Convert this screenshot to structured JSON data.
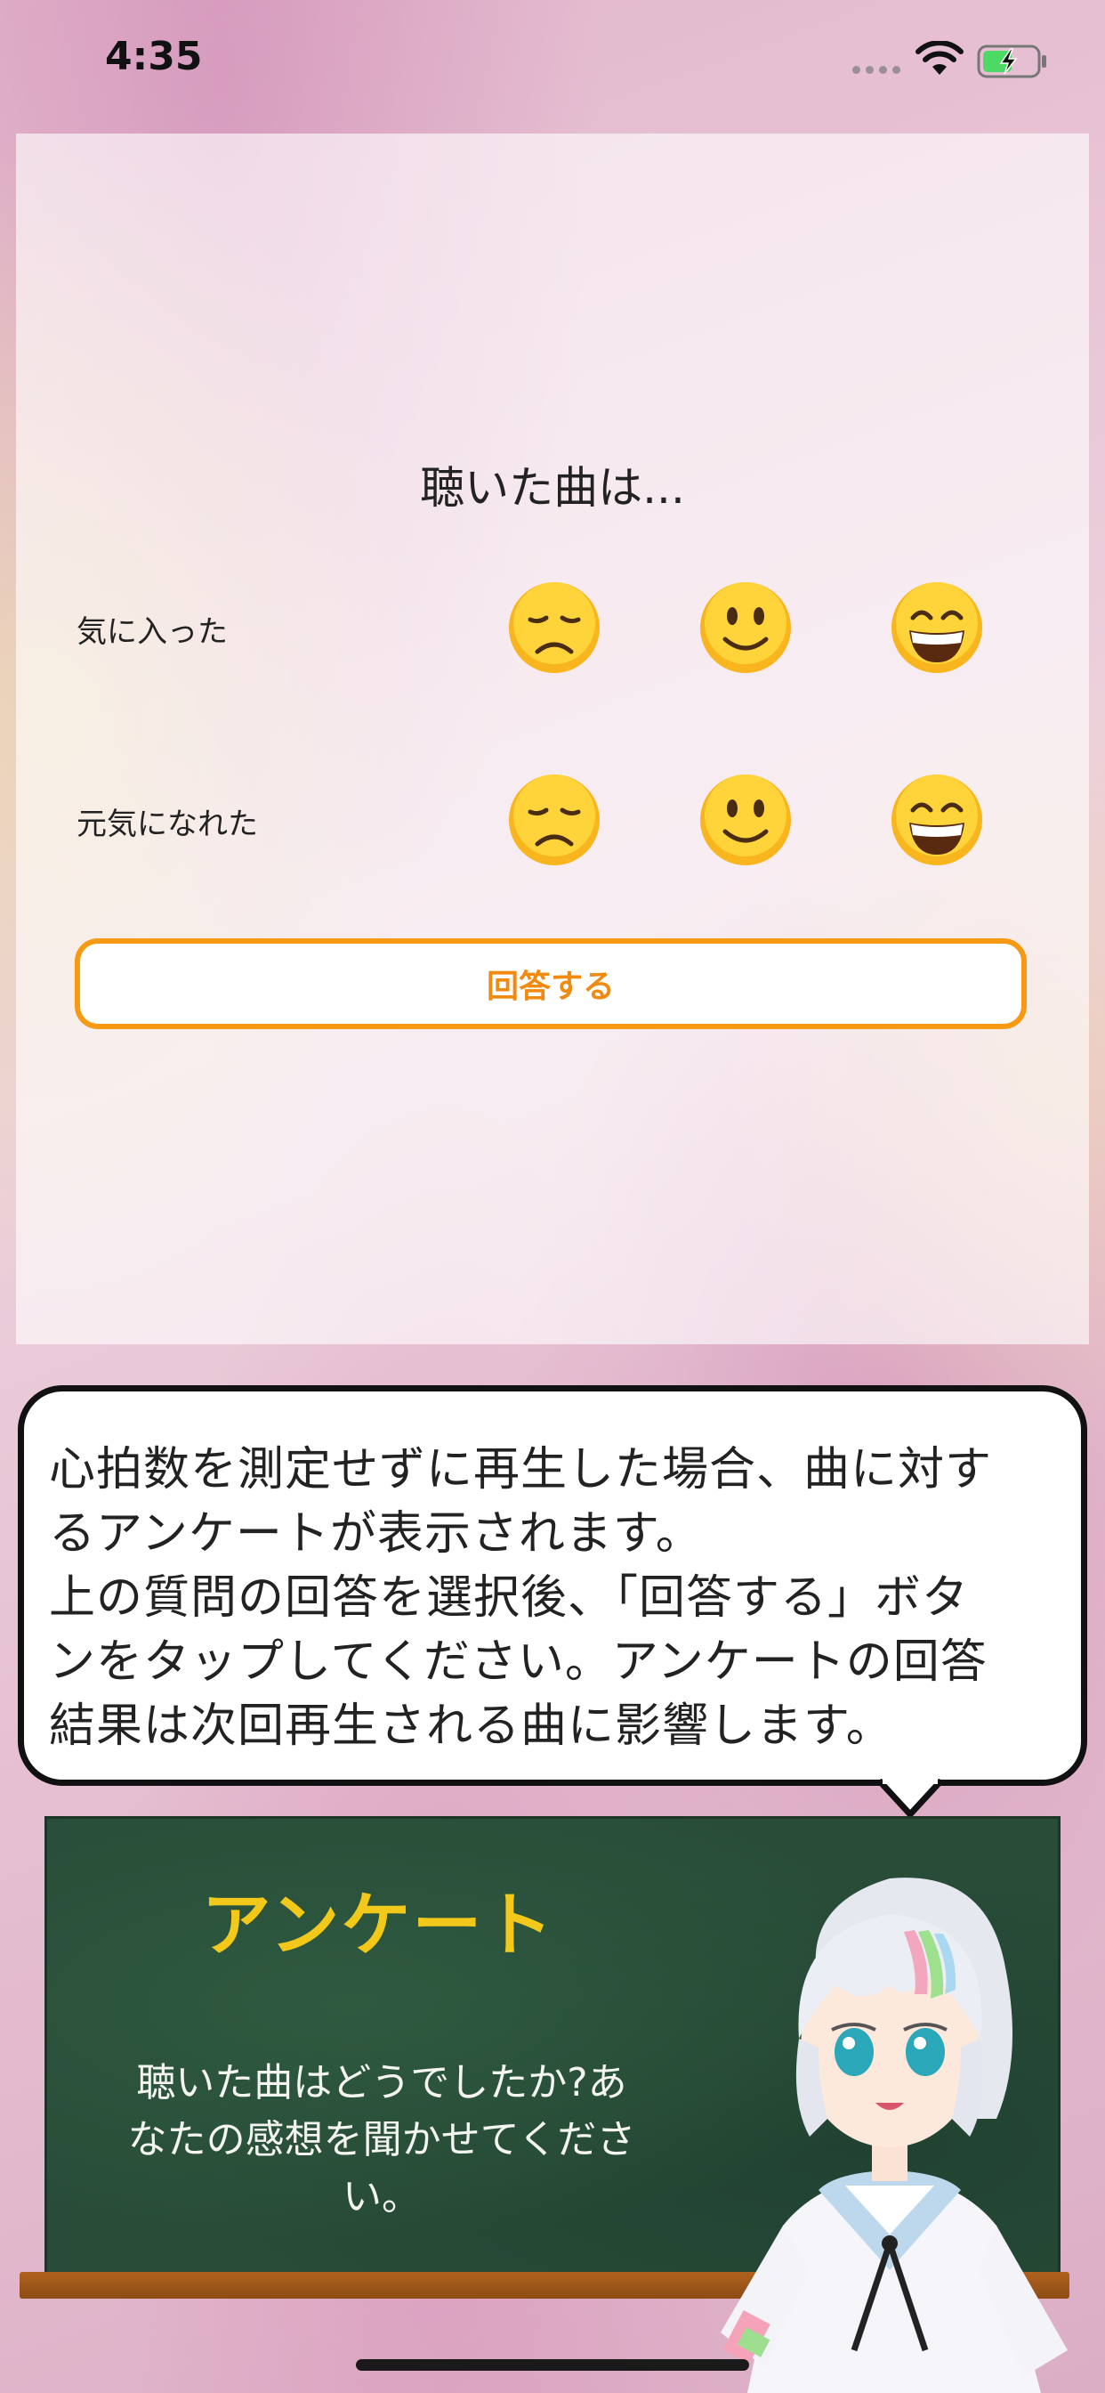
{
  "status_bar": {
    "time": "4:35",
    "icons": [
      "signal-dots-icon",
      "wifi-icon",
      "battery-charging-icon"
    ]
  },
  "survey": {
    "title": "聴いた曲は...",
    "rows": [
      {
        "label": "気に入った",
        "options": [
          "disappointed-face",
          "slightly-smiling-face",
          "grinning-face"
        ]
      },
      {
        "label": "元気になれた",
        "options": [
          "disappointed-face",
          "slightly-smiling-face",
          "grinning-face"
        ]
      }
    ],
    "submit_label": "回答する"
  },
  "speech_bubble": {
    "lines": [
      "心拍数を測定せずに再生した場合、曲に対す",
      "るアンケートが表示されます。",
      "上の質問の回答を選択後、「回答する」ボタ",
      "ンをタップしてください。アンケートの回答",
      "結果は次回再生される曲に影響します。"
    ]
  },
  "board": {
    "title": "アンケート",
    "lines": [
      "聴いた曲はどうでしたか?あ",
      "なたの感想を聞かせてくださ",
      "い。"
    ]
  },
  "colors": {
    "accent_orange": "#f59a12",
    "board_green": "#284c38",
    "board_title_yellow": "#f2c81a"
  }
}
